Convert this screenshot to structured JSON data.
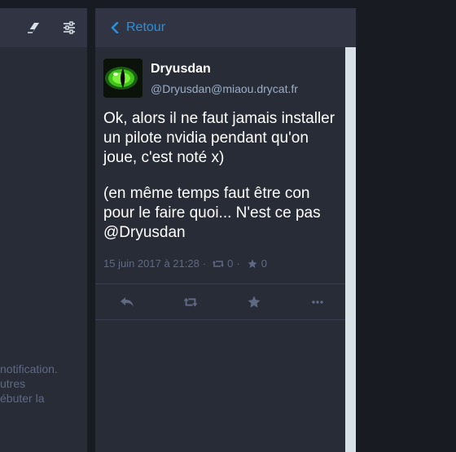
{
  "left_column": {
    "header_icons": [
      "eraser-icon",
      "sliders-icon"
    ],
    "notice_lines": [
      "notification.",
      "utres",
      "ébuter la"
    ]
  },
  "detail_column": {
    "back_label": "Retour",
    "status": {
      "display_name": "Dryusdan",
      "acct": "@Dryusdan@miaou.drycat.fr",
      "paragraphs": [
        "Ok, alors il ne faut jamais installer un pilote nvidia pendant qu'on joue, c'est noté x)",
        "(en même temps faut être con pour le faire quoi... N'est ce pas @Dryusdan"
      ],
      "timestamp": "15 juin 2017 à 21:28",
      "separator": "·",
      "reblogs": "0",
      "favourites": "0"
    },
    "actions": [
      "reply-icon",
      "boost-icon",
      "favourite-icon",
      "more-icon"
    ]
  },
  "colors": {
    "background": "#191b22",
    "column": "#282c37",
    "header": "#313543",
    "accent": "#2b90d9",
    "muted": "#606984"
  }
}
